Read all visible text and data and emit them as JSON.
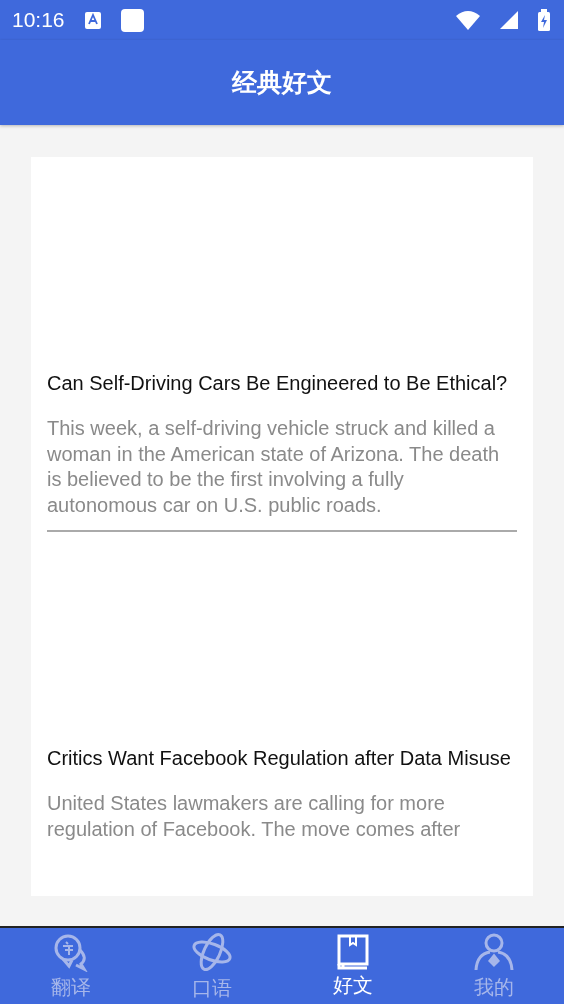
{
  "status_bar": {
    "time": "10:16"
  },
  "header": {
    "title": "经典好文"
  },
  "articles": [
    {
      "title": "Can Self-Driving Cars Be Engineered to Be Ethical?",
      "summary": "This week, a self-driving vehicle struck and killed a woman in the American state of Arizona. The death is believed to be the first involving a fully autonomous car on U.S. public roads."
    },
    {
      "title": "Critics Want Facebook Regulation after Data Misuse",
      "summary": "United States lawmakers are calling for more regulation of Facebook. The move comes after"
    }
  ],
  "bottom_nav": [
    {
      "label": "翻译",
      "kind": "translate",
      "selected": false
    },
    {
      "label": "口语",
      "kind": "atom",
      "selected": false
    },
    {
      "label": "好文",
      "kind": "book",
      "selected": true
    },
    {
      "label": "我的",
      "kind": "person",
      "selected": false
    }
  ]
}
